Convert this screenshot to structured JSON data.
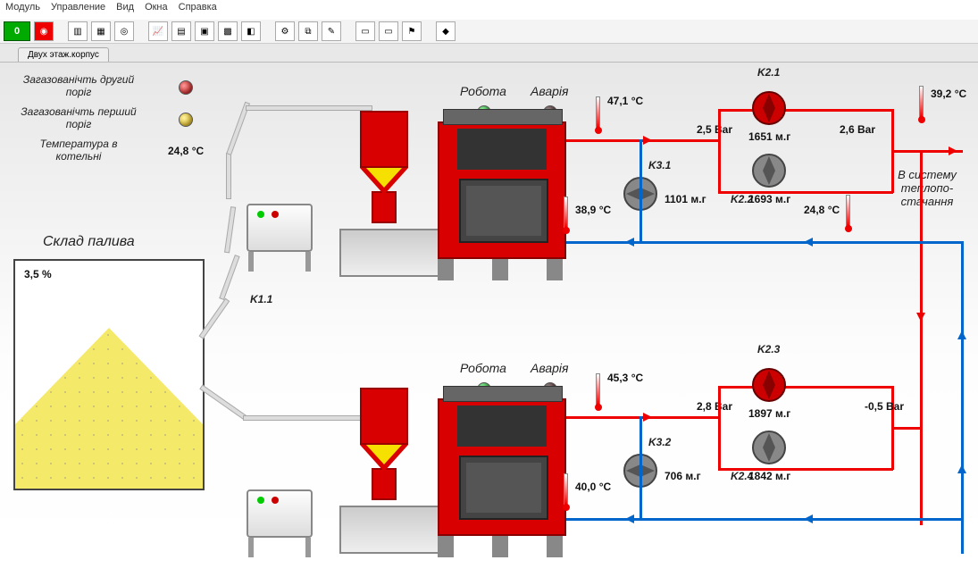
{
  "menu": {
    "module": "Модуль",
    "manage": "Управление",
    "view": "Вид",
    "windows": "Окна",
    "help": "Справка"
  },
  "toolbar": {
    "counter": "0"
  },
  "tab": {
    "label": "Двух этаж.корпус"
  },
  "alarms": {
    "gas2": "Загазованічть другий поріг",
    "gas1": "Загазованічть перший поріг",
    "temp_room_lbl": "Температура в котельні",
    "temp_room_val": "24,8 °C"
  },
  "silo": {
    "title": "Склад палива",
    "level": "3,5 %"
  },
  "feeders": {
    "k11": "K1.1"
  },
  "boiler1": {
    "work": "Робота",
    "alarm": "Аварія",
    "t_out": "47,1 °C",
    "t_ret": "38,9 °C",
    "p": "2,5 Bar"
  },
  "boiler2": {
    "work": "Робота",
    "alarm": "Аварія",
    "t_out": "45,3 °C",
    "t_ret": "40,0 °C",
    "p": "2,8 Bar"
  },
  "pumps": {
    "k21": {
      "name": "K2.1",
      "val": "1651 м.г"
    },
    "k22": {
      "name": "K2.2",
      "val": "1693 м.г"
    },
    "k31": {
      "name": "K3.1",
      "val": "1101 м.г"
    },
    "k23": {
      "name": "K2.3",
      "val": "1897 м.г"
    },
    "k24": {
      "name": "K2.4",
      "val": "1842 м.г"
    },
    "k32": {
      "name": "K3.2",
      "val": "706 м.г"
    }
  },
  "supply": {
    "t_sup": "39,2 °C",
    "p_sup": "2,6 Bar",
    "t_ret": "24,8 °C",
    "p2": "-0,5 Bar",
    "label": "В систему теплопо-стачання"
  }
}
